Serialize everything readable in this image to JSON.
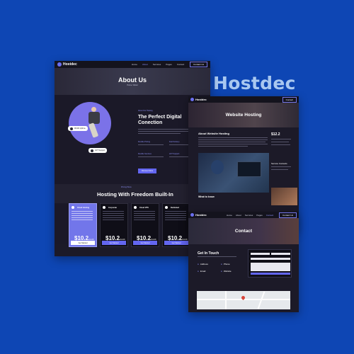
{
  "brand_title": "Hostdec",
  "theme": {
    "accent": "#6366f1",
    "background": "#0e46b4",
    "panel": "#1c1a28"
  },
  "mockup_about": {
    "nav": {
      "logo": "Hostdec",
      "links": [
        "Home",
        "About",
        "Services",
        "Pages",
        "Contact"
      ],
      "cta": "Contact Us"
    },
    "hero": {
      "title": "About Us",
      "breadcrumb": "Home / About"
    },
    "chips": [
      "99.9% Uptime",
      "24/7 Support"
    ],
    "section": {
      "label": "About Our Hosting",
      "title": "The Perfect Digital Conection",
      "features": [
        "Flexible Pricing",
        "Fast Delivery",
        "Flexible Services",
        "24/7 Support"
      ],
      "cta": "Discover More"
    },
    "hosting": {
      "label": "Pricing Plans",
      "title": "Hosting With Freedom Built-In",
      "plans": [
        {
          "name": "Cloud Hosting",
          "price": "$10.2",
          "period": "/month",
          "button": "Get Started",
          "featured": true
        },
        {
          "name": "Corporate",
          "price": "$10.2",
          "period": "/month",
          "button": "Get Started",
          "featured": false
        },
        {
          "name": "Cloud VPS",
          "price": "$10.2",
          "period": "/month",
          "button": "Get Started",
          "featured": false
        },
        {
          "name": "Dedicated",
          "price": "$10.2",
          "period": "/month",
          "button": "Get Started",
          "featured": false
        }
      ]
    }
  },
  "mockup_service": {
    "nav": {
      "logo": "Hostdec",
      "cta": "Contact"
    },
    "hero": {
      "title": "Website Hosting"
    },
    "about_title": "About Website Hosting",
    "know_title": "What to know",
    "side_price": "$12.2",
    "side_label": "Service Contacts"
  },
  "mockup_contact": {
    "nav": {
      "logo": "Hostdec",
      "links": [
        "Home",
        "About",
        "Services",
        "Pages",
        "Contact"
      ],
      "cta": "Contact Us"
    },
    "hero": {
      "title": "Contact"
    },
    "title": "Get In Touch",
    "info": [
      "Address",
      "Phone",
      "Email",
      "Website"
    ]
  }
}
